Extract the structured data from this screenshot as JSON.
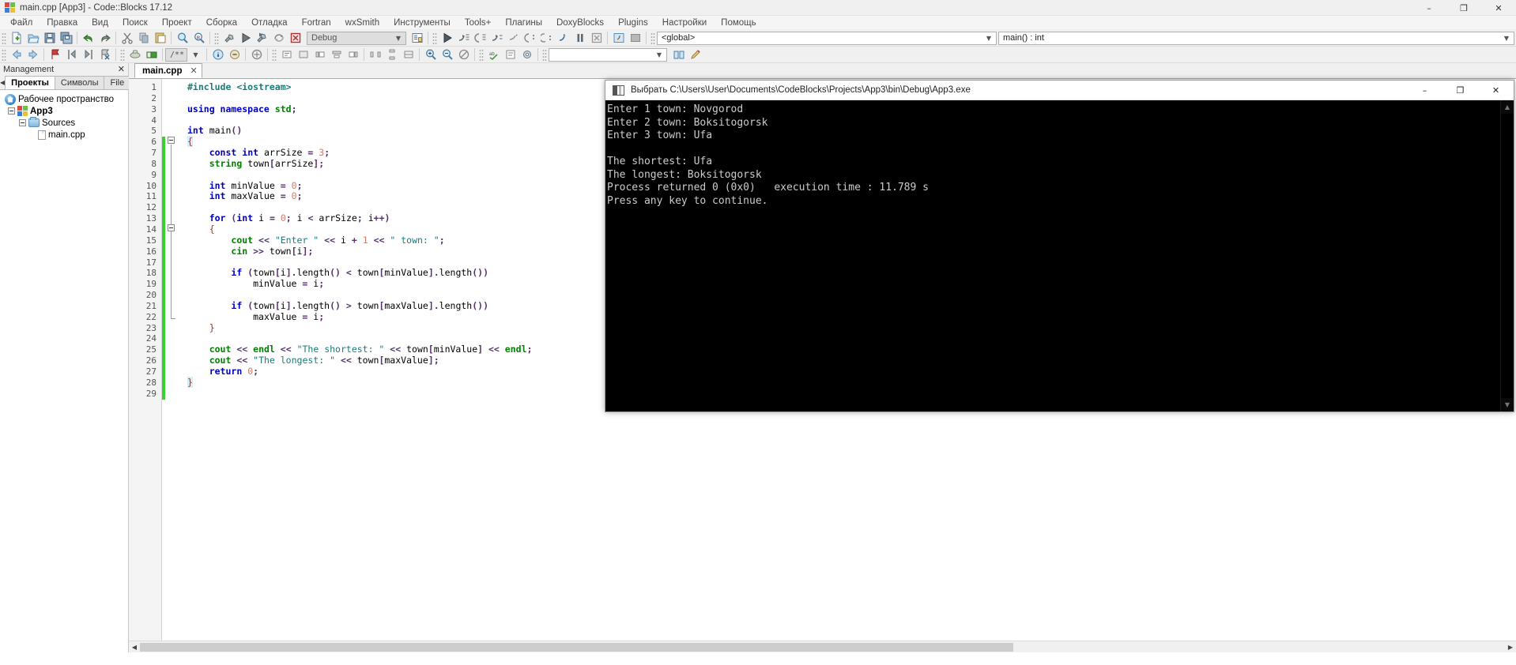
{
  "window": {
    "title": "main.cpp [App3] - Code::Blocks 17.12",
    "app_icon": "codeblocks-logo-icon",
    "minimize": "–",
    "maximize": "❐",
    "close": "✕"
  },
  "menubar": [
    {
      "label": "Файл"
    },
    {
      "label": "Правка"
    },
    {
      "label": "Вид"
    },
    {
      "label": "Поиск"
    },
    {
      "label": "Проект"
    },
    {
      "label": "Сборка"
    },
    {
      "label": "Отладка"
    },
    {
      "label": "Fortran"
    },
    {
      "label": "wxSmith"
    },
    {
      "label": "Инструменты"
    },
    {
      "label": "Tools+"
    },
    {
      "label": "Плагины"
    },
    {
      "label": "DoxyBlocks"
    },
    {
      "label": "Plugins"
    },
    {
      "label": "Настройки"
    },
    {
      "label": "Помощь"
    }
  ],
  "toolbar_row1": {
    "icons": [
      "new-file-icon",
      "open-file-icon",
      "save-icon",
      "save-all-icon",
      "undo-icon",
      "redo-icon",
      "cut-icon",
      "copy-icon",
      "paste-icon",
      "find-icon",
      "replace-icon"
    ],
    "build_icons": [
      "build-icon",
      "run-icon",
      "build-and-run-icon",
      "rebuild-icon",
      "abort-icon"
    ],
    "target_combo": {
      "value": "Debug",
      "arrow": "▼"
    },
    "target_extra_icon": "build-target-options-icon",
    "debug_icons": [
      "debug-continue-icon",
      "next-line-icon",
      "step-into-icon",
      "step-out-icon",
      "next-instruction-icon",
      "step-into-instruction-icon",
      "run-to-cursor-icon",
      "break-debugger-icon",
      "stop-debugger-icon"
    ],
    "debug_window_icons": [
      "debugging-windows-icon",
      "various-info-icon"
    ],
    "scope_combo": {
      "value": "<global>",
      "arrow": "▼"
    },
    "function_combo": {
      "value": "main() : int",
      "arrow": "▼"
    }
  },
  "toolbar_row2": {
    "nav_icons": [
      "back-icon",
      "forward-icon"
    ],
    "bookmark_icons": [
      "toggle-bookmark-icon",
      "previous-bookmark-icon",
      "next-bookmark-icon",
      "clear-bookmarks-icon"
    ],
    "doxy_icons": [
      "doxyblocks-extract-icon",
      "doxyblocks-run-icon"
    ],
    "comment_combo": {
      "value": "/** *<",
      "arrow": "▼"
    },
    "fortran_icons": [
      "fortran-info-icon",
      "fortran-refresh-icon"
    ],
    "tools_icons": [
      "tools-plus-icon",
      "tools-config-icon"
    ],
    "wx_icons": [
      "wxsmith-icon"
    ],
    "wx_combo": {
      "value": "",
      "arrow": "▼"
    },
    "align_icons": [
      "insert-code-icon",
      "insert-block-icon",
      "align-left-icon",
      "align-center-icon",
      "align-right-icon",
      "distribute-h-icon",
      "distribute-v-icon",
      "same-width-icon"
    ],
    "zoom_icons": [
      "zoom-in-icon",
      "zoom-out-icon",
      "zoom-reset-icon",
      "spell-check-icon"
    ],
    "spell_combo": {
      "value": "",
      "arrow": "▼"
    },
    "end_icons": [
      "thesaurus-icon",
      "spell-settings-icon"
    ]
  },
  "management": {
    "header": "Management",
    "close_icon": "✕",
    "scroll_left_icon": "◀",
    "scroll_right_icon": "▶",
    "tabs": [
      {
        "label": "Проекты",
        "active": true
      },
      {
        "label": "Символы",
        "active": false
      },
      {
        "label": "File",
        "active": false
      }
    ],
    "tree": [
      {
        "label": "Рабочее пространство",
        "icon": "workspace-icon",
        "depth": 0,
        "bold": false,
        "expander": false
      },
      {
        "label": "App3",
        "icon": "project-icon",
        "depth": 1,
        "bold": true,
        "expander": true
      },
      {
        "label": "Sources",
        "icon": "folder-icon",
        "depth": 2,
        "bold": false,
        "expander": true
      },
      {
        "label": "main.cpp",
        "icon": "source-file-icon",
        "depth": 3,
        "bold": false,
        "expander": false
      }
    ]
  },
  "editor": {
    "tab_label": "main.cpp",
    "tab_close_icon": "✕",
    "line_count": 29,
    "lines": [
      {
        "n": 1,
        "html": "<span class='pp'>#include</span> <span class='pp'>&lt;iostream&gt;</span>"
      },
      {
        "n": 2,
        "html": ""
      },
      {
        "n": 3,
        "html": "<span class='k'>using namespace</span> <span class='k2'>std</span><span class='op'>;</span>"
      },
      {
        "n": 4,
        "html": ""
      },
      {
        "n": 5,
        "html": "<span class='k'>int</span> <span class='pl'>main</span><span class='op'>()</span>"
      },
      {
        "n": 6,
        "html": "<span class='br brace-hl'>{</span>"
      },
      {
        "n": 7,
        "html": "    <span class='k'>const</span> <span class='k'>int</span> <span class='pl'>arrSize</span> <span class='op'>=</span> <span class='nm'>3</span><span class='op'>;</span>"
      },
      {
        "n": 8,
        "html": "    <span class='k2'>string</span> <span class='pl'>town</span><span class='op'>[</span><span class='pl'>arrSize</span><span class='op'>];</span>"
      },
      {
        "n": 9,
        "html": ""
      },
      {
        "n": 10,
        "html": "    <span class='k'>int</span> <span class='pl'>minValue</span> <span class='op'>=</span> <span class='nm'>0</span><span class='op'>;</span>"
      },
      {
        "n": 11,
        "html": "    <span class='k'>int</span> <span class='pl'>maxValue</span> <span class='op'>=</span> <span class='nm'>0</span><span class='op'>;</span>"
      },
      {
        "n": 12,
        "html": ""
      },
      {
        "n": 13,
        "html": "    <span class='k'>for</span> <span class='op'>(</span><span class='k'>int</span> <span class='pl'>i</span> <span class='op'>=</span> <span class='nm'>0</span><span class='op'>;</span> <span class='pl'>i</span> <span class='op'>&lt;</span> <span class='pl'>arrSize</span><span class='op'>;</span> <span class='pl'>i</span><span class='op'>++)</span>"
      },
      {
        "n": 14,
        "html": "    <span class='br'>{</span>"
      },
      {
        "n": 15,
        "html": "        <span class='k2'>cout</span> <span class='op'>&lt;&lt;</span> <span class='st'>\"Enter \"</span> <span class='op'>&lt;&lt;</span> <span class='pl'>i</span> <span class='op'>+</span> <span class='nm'>1</span> <span class='op'>&lt;&lt;</span> <span class='st'>\" town: \"</span><span class='op'>;</span>"
      },
      {
        "n": 16,
        "html": "        <span class='k2'>cin</span> <span class='op'>&gt;&gt;</span> <span class='pl'>town</span><span class='op'>[</span><span class='pl'>i</span><span class='op'>];</span>"
      },
      {
        "n": 17,
        "html": ""
      },
      {
        "n": 18,
        "html": "        <span class='k'>if</span> <span class='op'>(</span><span class='pl'>town</span><span class='op'>[</span><span class='pl'>i</span><span class='op'>].</span><span class='pl'>length</span><span class='op'>()</span> <span class='op'>&lt;</span> <span class='pl'>town</span><span class='op'>[</span><span class='pl'>minValue</span><span class='op'>].</span><span class='pl'>length</span><span class='op'>())</span>"
      },
      {
        "n": 19,
        "html": "            <span class='pl'>minValue</span> <span class='op'>=</span> <span class='pl'>i</span><span class='op'>;</span>"
      },
      {
        "n": 20,
        "html": ""
      },
      {
        "n": 21,
        "html": "        <span class='k'>if</span> <span class='op'>(</span><span class='pl'>town</span><span class='op'>[</span><span class='pl'>i</span><span class='op'>].</span><span class='pl'>length</span><span class='op'>()</span> <span class='op'>&gt;</span> <span class='pl'>town</span><span class='op'>[</span><span class='pl'>maxValue</span><span class='op'>].</span><span class='pl'>length</span><span class='op'>())</span>"
      },
      {
        "n": 22,
        "html": "            <span class='pl'>maxValue</span> <span class='op'>=</span> <span class='pl'>i</span><span class='op'>;</span>"
      },
      {
        "n": 23,
        "html": "    <span class='br'>}</span>"
      },
      {
        "n": 24,
        "html": ""
      },
      {
        "n": 25,
        "html": "    <span class='k2'>cout</span> <span class='op'>&lt;&lt;</span> <span class='k2'>endl</span> <span class='op'>&lt;&lt;</span> <span class='st'>\"The shortest: \"</span> <span class='op'>&lt;&lt;</span> <span class='pl'>town</span><span class='op'>[</span><span class='pl'>minValue</span><span class='op'>]</span> <span class='op'>&lt;&lt;</span> <span class='k2'>endl</span><span class='op'>;</span>"
      },
      {
        "n": 26,
        "html": "    <span class='k2'>cout</span> <span class='op'>&lt;&lt;</span> <span class='st'>\"The longest: \"</span> <span class='op'>&lt;&lt;</span> <span class='pl'>town</span><span class='op'>[</span><span class='pl'>maxValue</span><span class='op'>];</span>"
      },
      {
        "n": 27,
        "html": "    <span class='k'>return</span> <span class='nm'>0</span><span class='op'>;</span>"
      },
      {
        "n": 28,
        "html": "<span class='br brace-hl'>}</span>"
      },
      {
        "n": 29,
        "html": ""
      }
    ],
    "scroll_left_icon": "◀",
    "scroll_right_icon": "▶"
  },
  "console": {
    "title": "Выбрать C:\\Users\\User\\Documents\\CodeBlocks\\Projects\\App3\\bin\\Debug\\App3.exe",
    "icon": "console-window-icon",
    "minimize": "–",
    "maximize": "❐",
    "close": "✕",
    "scroll_up_icon": "▲",
    "scroll_down_icon": "▼",
    "output": "Enter 1 town: Novgorod\nEnter 2 town: Boksitogorsk\nEnter 3 town: Ufa\n\nThe shortest: Ufa\nThe longest: Boksitogorsk\nProcess returned 0 (0x0)   execution time : 11.789 s\nPress any key to continue."
  },
  "colors": {
    "accent": "#3b7fd4",
    "changebar_green": "#35d135",
    "console_bg": "#000000",
    "console_fg": "#cccccc",
    "keyword_blue": "#0000c0",
    "string_teal": "#1c7a7a",
    "number_red": "#d17b6b"
  }
}
